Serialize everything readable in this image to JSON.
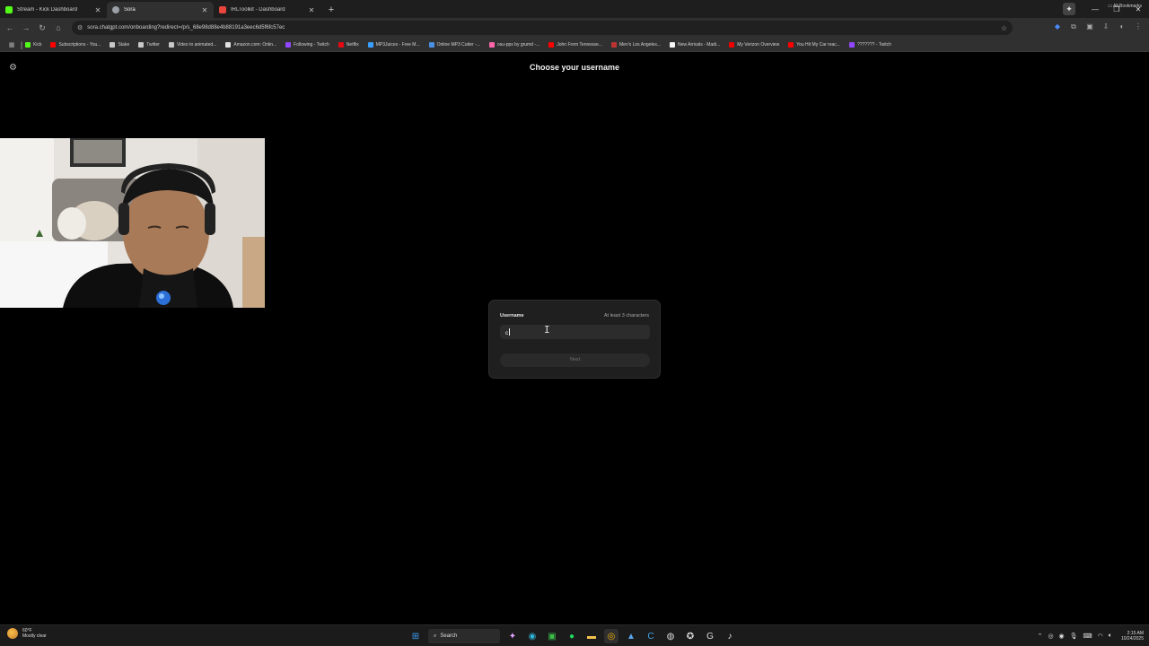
{
  "browser": {
    "tabs": [
      {
        "title": "Stream - Kick Dashboard",
        "icon": "kick-icon",
        "color": "#53fc18",
        "active": false
      },
      {
        "title": "Sora",
        "icon": "openai-icon",
        "color": "#9aa0a6",
        "active": true
      },
      {
        "title": "IRLToolkit - Dashboard",
        "icon": "irltoolkit-icon",
        "color": "#e8453c",
        "active": false
      }
    ],
    "address": "sora.chatgpt.com/onboarding?redirect=/p/s_68e98d88e4b88191a3eec6d5f6fc57ec",
    "bookmarks": [
      {
        "label": "Kick",
        "color": "#53fc18"
      },
      {
        "label": "Subscriptions - You...",
        "color": "#ff0000"
      },
      {
        "label": "Stake",
        "color": "#c8c8c8"
      },
      {
        "label": "Twitter",
        "color": "#c8c8c8"
      },
      {
        "label": "Video to animated...",
        "color": "#c8c8c8"
      },
      {
        "label": "Amazon.com: Onlin...",
        "color": "#e0e0e0"
      },
      {
        "label": "Following - Twitch",
        "color": "#9146ff"
      },
      {
        "label": "Netflix",
        "color": "#e50914"
      },
      {
        "label": "MP3Juices - Free M...",
        "color": "#3aa0ff"
      },
      {
        "label": "Online MP3 Cutter -...",
        "color": "#4a90e2"
      },
      {
        "label": "osu-pps by grumd -...",
        "color": "#ff66aa"
      },
      {
        "label": "John From Tennesse...",
        "color": "#ff0000"
      },
      {
        "label": "Men's Los Angeles...",
        "color": "#b33"
      },
      {
        "label": "New Arrivals - Madi...",
        "color": "#f5f5f5"
      },
      {
        "label": "My Verizon Overview",
        "color": "#e00"
      },
      {
        "label": "You Hit My Car reac...",
        "color": "#ff0000"
      },
      {
        "label": "??????? - Twitch",
        "color": "#9146ff"
      }
    ],
    "all_bookmarks": "All Bookmarks"
  },
  "page": {
    "title": "Choose your username",
    "form": {
      "label": "Username",
      "hint": "At least 3 characters",
      "value": "c",
      "next_label": "Next"
    }
  },
  "taskbar": {
    "weather_temp": "60°F",
    "weather_desc": "Mostly clear",
    "search_label": "Search",
    "time": "2:15 AM",
    "date": "10/24/2025"
  }
}
